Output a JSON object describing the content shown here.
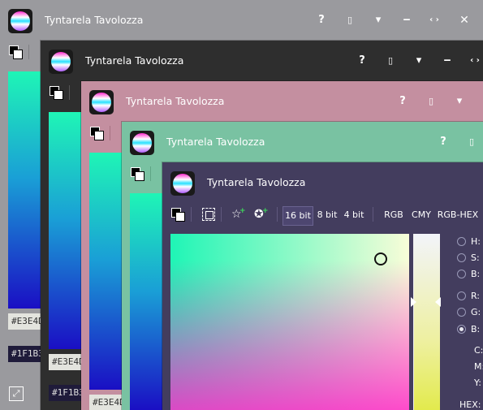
{
  "windows": [
    {
      "title": "Tyntarela Tavolozza",
      "hex_fields": [
        "#E3E4D",
        "#1F1B3"
      ],
      "buttons": {
        "help": "?",
        "clipboard": "▯",
        "menu": "▾",
        "minimize": "‒",
        "resize": "‹ ›",
        "close": "✕"
      }
    },
    {
      "title": "Tyntarela Tavolozza",
      "hex_fields": [
        "#E3E4D",
        "#1F1B3"
      ],
      "buttons": {
        "help": "?",
        "clipboard": "▯",
        "menu": "▾",
        "minimize": "‒",
        "resize": "‹ ›"
      }
    },
    {
      "title": "Tyntarela Tavolozza",
      "hex_fields": [
        "#E3E4D"
      ],
      "buttons": {
        "help": "?",
        "clipboard": "▯",
        "menu": "▾"
      }
    },
    {
      "title": "Tyntarela Tavolozza",
      "buttons": {
        "help": "?",
        "clipboard": "▯"
      }
    },
    {
      "title": "Tyntarela Tavolozza",
      "toolbar": {
        "bit_16": "16 bit",
        "bit_8": "8 bit",
        "bit_4": "4 bit",
        "rgb": "RGB",
        "cmy": "CMY",
        "rgb_hex": "RGB-HEX"
      },
      "fields": {
        "h": "H:",
        "s": "S:",
        "b_hsb": "B:",
        "r": "R:",
        "g": "G:",
        "b_rgb": "B:",
        "c": "C:",
        "m": "M:",
        "y": "Y:",
        "hex": "HEX:"
      },
      "selected_mode": "B (RGB)",
      "selected_bit_depth": "16 bit"
    }
  ],
  "colors": {
    "win1_bg": "#9a9a9e",
    "win2_bg": "#2e2e2e",
    "win3_bg": "#c48fa0",
    "win4_bg": "#79c2a2",
    "win5_bg": "#433d5e",
    "gradient_top": "#1ff5b6",
    "gradient_bottom": "#1a0fc4"
  }
}
